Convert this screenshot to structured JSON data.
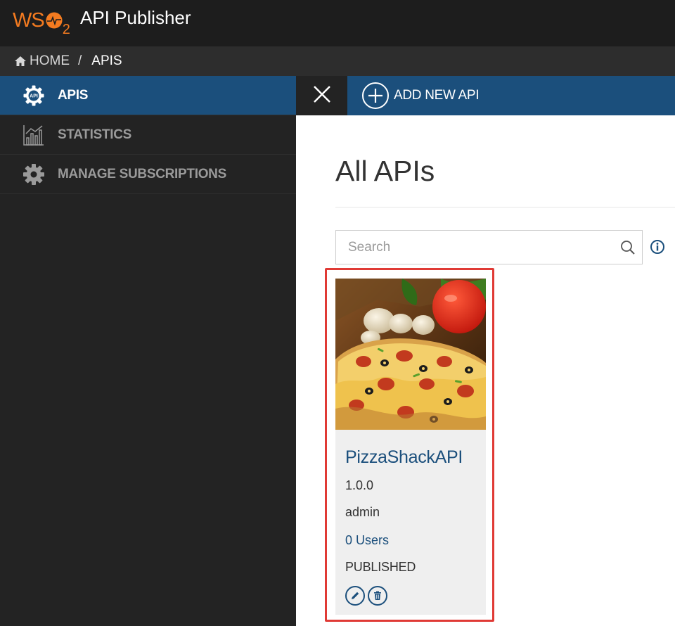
{
  "app": {
    "logo_text": "WSO2",
    "logo_ws": "WS",
    "logo_two": "2",
    "title": "API Publisher"
  },
  "breadcrumb": {
    "home": "HOME",
    "separator": "/",
    "current": "APIS"
  },
  "sidebar": {
    "items": [
      {
        "label": "APIS",
        "icon": "api-gear-icon",
        "active": true
      },
      {
        "label": "STATISTICS",
        "icon": "bar-chart-icon",
        "active": false
      },
      {
        "label": "MANAGE SUBSCRIPTIONS",
        "icon": "gear-icon",
        "active": false
      }
    ]
  },
  "toolbar": {
    "close_icon": "close-icon",
    "add_label": "ADD NEW API",
    "add_icon": "plus-circle-icon"
  },
  "main": {
    "title": "All APIs",
    "search": {
      "placeholder": "Search",
      "value": ""
    }
  },
  "apis": [
    {
      "name": "PizzaShackAPI",
      "version": "1.0.0",
      "owner": "admin",
      "users": "0 Users",
      "status": "PUBLISHED",
      "thumbnail": "pizza-image"
    }
  ],
  "colors": {
    "brand_orange": "#f47b20",
    "primary_blue": "#1b4f7c",
    "sidebar_bg": "#232323",
    "topbar_bg": "#1d1d1d",
    "highlight_red": "#e03a35"
  }
}
